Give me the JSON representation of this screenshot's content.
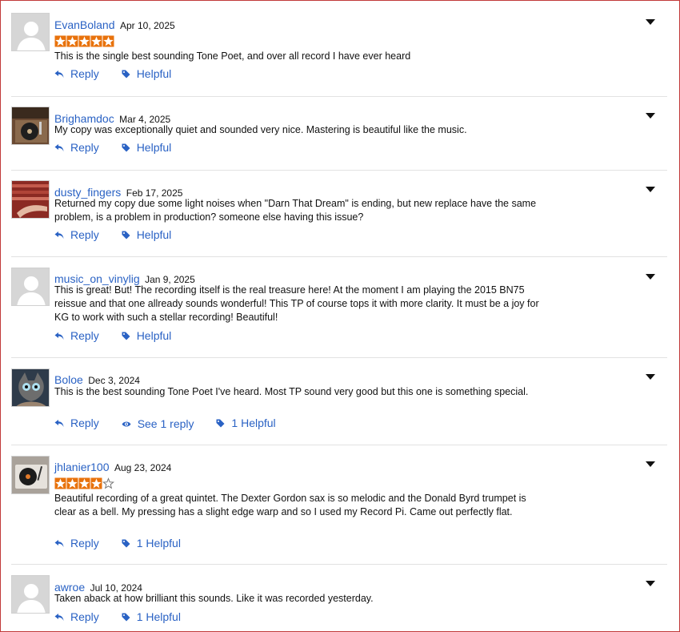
{
  "reviews": [
    {
      "user": "EvanBoland",
      "date": "Apr 10, 2025",
      "avatar": "default-avatar-icon",
      "rating": 5,
      "text": "This is the single best sounding Tone Poet, and over all record I have ever heard",
      "actions": {
        "reply": "Reply",
        "helpful": "Helpful"
      }
    },
    {
      "user": "Brighamdoc",
      "date": "Mar 4, 2025",
      "avatar": "turntable-photo",
      "text": "My copy was exceptionally quiet and sounded very nice. Mastering is beautiful like the music.",
      "actions": {
        "reply": "Reply",
        "helpful": "Helpful"
      }
    },
    {
      "user": "dusty_fingers",
      "date": "Feb 17, 2025",
      "avatar": "record-crate-photo",
      "text": "Returned my copy due some light noises when \"Darn That Dream\" is ending, but new replace have the same problem, is a problem in production? someone else having this issue?",
      "actions": {
        "reply": "Reply",
        "helpful": "Helpful"
      }
    },
    {
      "user": "music_on_vinylig",
      "date": "Jan 9, 2025",
      "avatar": "default-avatar-icon",
      "text": "This is great! But! The recording itself is the real treasure here! At the moment I am playing the 2015 BN75 reissue and that one allready sounds wonderful! This TP of course tops it with more clarity. It must be a joy for KG to work with such a stellar recording! Beautiful!",
      "actions": {
        "reply": "Reply",
        "helpful": "Helpful"
      }
    },
    {
      "user": "Boloe",
      "date": "Dec 3, 2024",
      "avatar": "cat-photo",
      "text": "This is the best sounding Tone Poet I've heard. Most TP sound very good but this one is something special.",
      "actions": {
        "reply": "Reply",
        "see_replies": "See 1 reply",
        "helpful": "1 Helpful"
      }
    },
    {
      "user": "jhlanier100",
      "date": "Aug 23, 2024",
      "avatar": "record-player-photo",
      "rating": 4,
      "text": "Beautiful recording of a great quintet. The Dexter Gordon sax is so melodic and the Donald Byrd trumpet is clear as a bell. My pressing has a slight edge warp and so I used my Record Pi. Came out perfectly flat.",
      "actions": {
        "reply": "Reply",
        "helpful": "1 Helpful"
      }
    },
    {
      "user": "awroe",
      "date": "Jul 10, 2024",
      "avatar": "default-avatar-icon",
      "text": "Taken aback at how brilliant this sounds. Like it was recorded yesterday.",
      "actions": {
        "reply": "Reply",
        "helpful": "1 Helpful"
      }
    }
  ],
  "colors": {
    "link": "#2a62c4",
    "star": "#e8720c",
    "border": "#c23a3a",
    "separator": "#e2e2e2"
  }
}
